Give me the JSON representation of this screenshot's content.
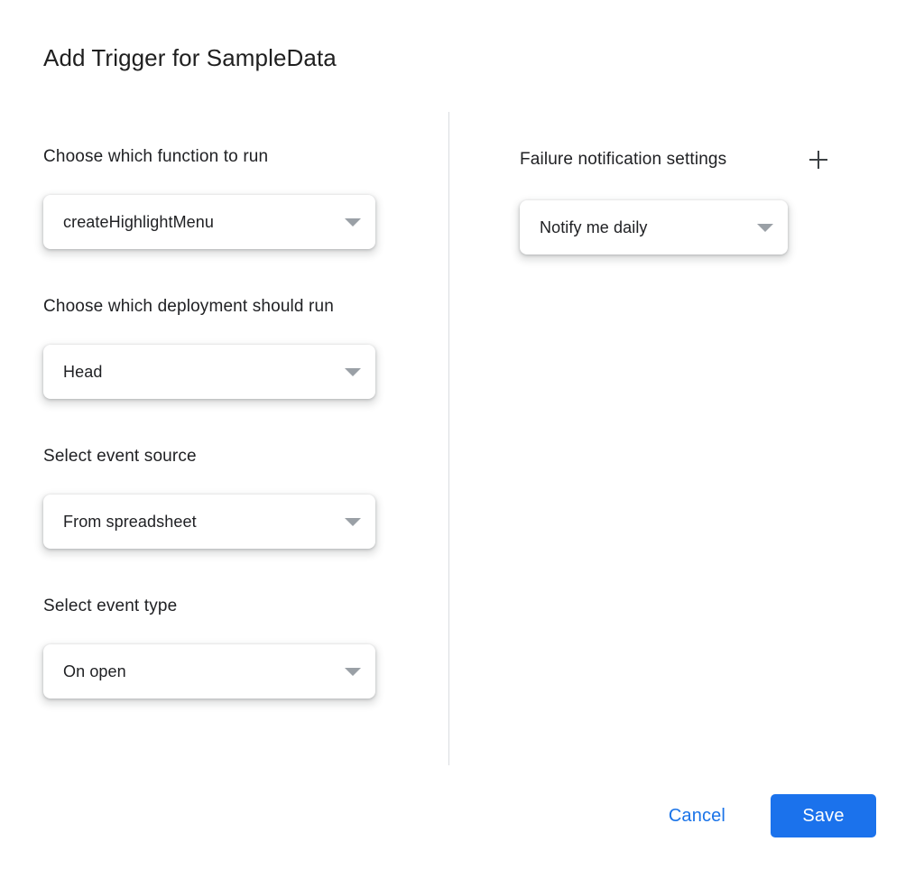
{
  "dialog": {
    "title": "Add Trigger for SampleData"
  },
  "left_column": {
    "fields": [
      {
        "label": "Choose which function to run",
        "value": "createHighlightMenu",
        "caret_icon": "chevron-down-icon"
      },
      {
        "label": "Choose which deployment should run",
        "value": "Head",
        "caret_icon": "chevron-down-icon"
      },
      {
        "label": "Select event source",
        "value": "From spreadsheet",
        "caret_icon": "chevron-down-icon"
      },
      {
        "label": "Select event type",
        "value": "On open",
        "caret_icon": "chevron-down-icon"
      }
    ]
  },
  "right_column": {
    "section_label": "Failure notification settings",
    "add_icon": "plus-icon",
    "fields": [
      {
        "label": "Failure notification settings",
        "value": "Notify me daily",
        "caret_icon": "chevron-down-icon"
      }
    ]
  },
  "footer": {
    "cancel_label": "Cancel",
    "save_label": "Save"
  },
  "colors": {
    "accent_blue": "#1b72ec",
    "link_blue": "#1a73e8",
    "text_primary": "#202124",
    "caret_gray": "#9aa0a6",
    "divider_gray": "#dadce0",
    "background": "#ffffff"
  }
}
